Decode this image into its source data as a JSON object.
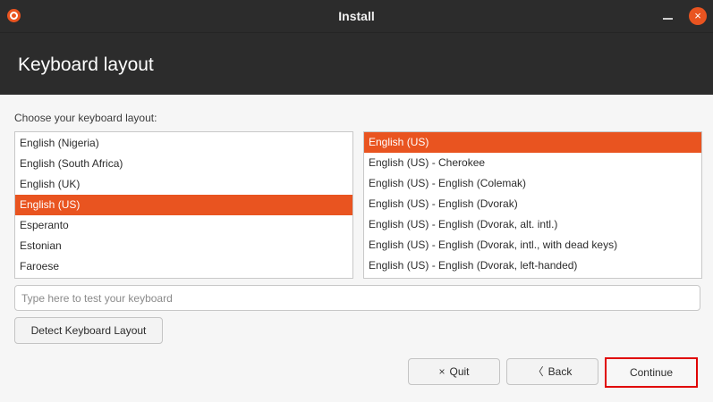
{
  "window": {
    "title": "Install",
    "close_glyph": "×",
    "icons": {
      "app": "ubuntu-logo-icon",
      "minimize": "minimize-icon",
      "close": "close-icon"
    },
    "accent_color": "#e95420"
  },
  "header": {
    "title": "Keyboard layout"
  },
  "prompt": "Choose your keyboard layout:",
  "layouts": {
    "selected": "English (US)",
    "items": [
      "English (Nigeria)",
      "English (South Africa)",
      "English (UK)",
      "English (US)",
      "Esperanto",
      "Estonian",
      "Faroese"
    ]
  },
  "variants": {
    "selected": "English (US)",
    "items": [
      "English (US)",
      "English (US) - Cherokee",
      "English (US) - English (Colemak)",
      "English (US) - English (Dvorak)",
      "English (US) - English (Dvorak, alt. intl.)",
      "English (US) - English (Dvorak, intl., with dead keys)",
      "English (US) - English (Dvorak, left-handed)"
    ]
  },
  "test_input": {
    "placeholder": "Type here to test your keyboard",
    "value": ""
  },
  "buttons": {
    "detect_label": "Detect Keyboard Layout",
    "quit_label": "Quit",
    "quit_icon": "×",
    "back_label": "Back",
    "back_icon": "〈",
    "continue_label": "Continue"
  }
}
